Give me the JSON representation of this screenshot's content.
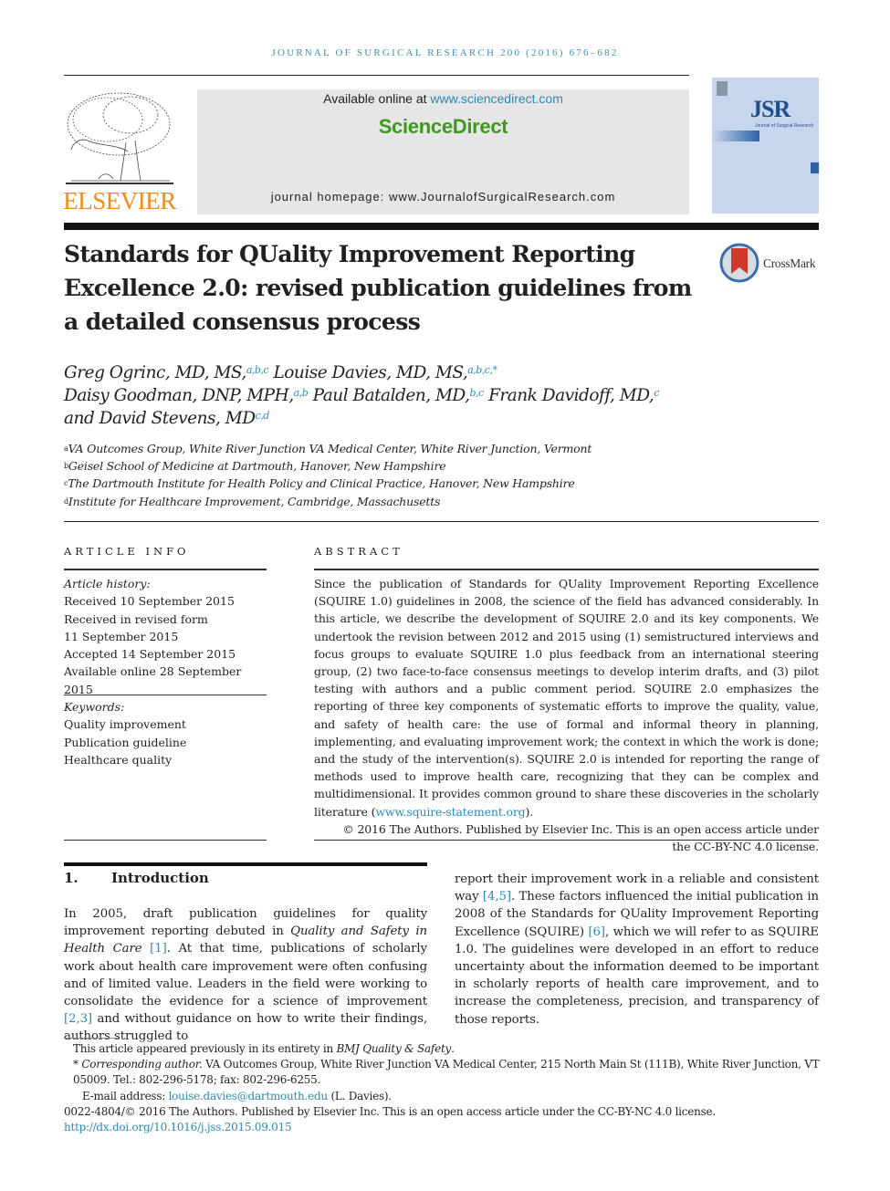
{
  "header": {
    "running_head": "JOURNAL OF SURGICAL RESEARCH 200 (2016) 676–682",
    "publisher_logo_text": "ELSEVIER",
    "available_online_prefix": "Available online at ",
    "available_online_link": "www.sciencedirect.com",
    "brand": "ScienceDirect",
    "journal_homepage": "journal homepage: www.JournalofSurgicalResearch.com",
    "cover": {
      "abbr": "JSR",
      "subtitle": "Journal of Surgical Research"
    },
    "crossmark_label": "CrossMark"
  },
  "colors": {
    "link": "#2a8bb8",
    "elsevier_orange": "#f08a1c",
    "sciencedirect_green": "#3c9a1d",
    "header_box": "#e6e6e6",
    "cover_blue": "#c7d6ec"
  },
  "article": {
    "title": "Standards for QUality Improvement Reporting Excellence 2.0: revised publication guidelines from a detailed consensus process",
    "authors": [
      {
        "name": "Greg Ogrinc, MD, MS,",
        "affil": "a,b,c"
      },
      {
        "name": "Louise Davies, MD, MS,",
        "affil": "a,b,c,*"
      },
      {
        "name": "Daisy Goodman, DNP, MPH,",
        "affil": "a,b"
      },
      {
        "name": "Paul Batalden, MD,",
        "affil": "b,c"
      },
      {
        "name": "Frank Davidoff, MD,",
        "affil": "c"
      },
      {
        "name": "and David Stevens, MD",
        "affil": "c,d"
      }
    ],
    "affiliations": [
      {
        "key": "a",
        "text": "VA Outcomes Group, White River Junction VA Medical Center, White River Junction, Vermont"
      },
      {
        "key": "b",
        "text": "Geisel School of Medicine at Dartmouth, Hanover, New Hampshire"
      },
      {
        "key": "c",
        "text": "The Dartmouth Institute for Health Policy and Clinical Practice, Hanover, New Hampshire"
      },
      {
        "key": "d",
        "text": "Institute for Healthcare Improvement, Cambridge, Massachusetts"
      }
    ]
  },
  "article_info": {
    "heading": "ARTICLE INFO",
    "history_label": "Article history:",
    "history": [
      "Received 10 September 2015",
      "Received in revised form",
      "11 September 2015",
      "Accepted 14 September 2015",
      "Available online 28 September 2015"
    ],
    "keywords_label": "Keywords:",
    "keywords": [
      "Quality improvement",
      "Publication guideline",
      "Healthcare quality"
    ]
  },
  "abstract": {
    "heading": "ABSTRACT",
    "body": "Since the publication of Standards for QUality Improvement Reporting Excellence (SQUIRE 1.0) guidelines in 2008, the science of the field has advanced considerably. In this article, we describe the development of SQUIRE 2.0 and its key components. We undertook the revision between 2012 and 2015 using (1) semistructured interviews and focus groups to evaluate SQUIRE 1.0 plus feedback from an international steering group, (2) two face-to-face consensus meetings to develop interim drafts, and (3) pilot testing with authors and a public comment period. SQUIRE 2.0 emphasizes the reporting of three key components of systematic efforts to improve the quality, value, and safety of health care: the use of formal and informal theory in planning, implementing, and evaluating improvement work; the context in which the work is done; and the study of the intervention(s). SQUIRE 2.0 is intended for reporting the range of methods used to improve health care, recognizing that they can be complex and multidimensional. It provides common ground to share these discoveries in the scholarly literature (",
    "link": "www.squire-statement.org",
    "body_end": ").",
    "copyright": "© 2016 The Authors. Published by Elsevier Inc. This is an open access article under the CC-BY-NC 4.0 license."
  },
  "introduction": {
    "number": "1.",
    "heading": "Introduction",
    "col1_a": "In 2005, draft publication guidelines for quality improvement reporting debuted in ",
    "col1_italic": "Quality and Safety in Health Care",
    "col1_ref1": "[1]",
    "col1_b": ". At that time, publications of scholarly work about health care improvement were often confusing and of limited value. Leaders in the field were working to consolidate the evidence for a science of improvement ",
    "col1_ref2": "[2,3]",
    "col1_c": " and without guidance on how to write their findings, authors struggled to",
    "col2_a": "report their improvement work in a reliable and consistent way ",
    "col2_ref1": "[4,5]",
    "col2_b": ". These factors influenced the initial publication in 2008 of the Standards for QUality Improvement Reporting Excellence (SQUIRE) ",
    "col2_ref2": "[6]",
    "col2_c": ", which we will refer to as SQUIRE 1.0. The guidelines were developed in an effort to reduce uncertainty about the information deemed to be important in scholarly reports of health care improvement, and to increase the completeness, precision, and transparency of those reports."
  },
  "footnotes": {
    "note1_a": "This article appeared previously in its entirety in ",
    "note1_italic": "BMJ Quality & Safety",
    "note1_b": ".",
    "corr_star": "* ",
    "corr_label": "Corresponding author.",
    "corr_text": " VA Outcomes Group, White River Junction VA Medical Center, 215 North Main St (111B), White River Junction, VT 05009. Tel.: 802-296-5178; fax: 802-296-6255.",
    "email_label": "E-mail address: ",
    "email": "louise.davies@dartmouth.edu",
    "email_suffix": " (L. Davies).",
    "issn_line": "0022-4804/© 2016 The Authors. Published by Elsevier Inc. This is an open access article under the CC-BY-NC 4.0 license.",
    "doi": "http://dx.doi.org/10.1016/j.jss.2015.09.015"
  }
}
